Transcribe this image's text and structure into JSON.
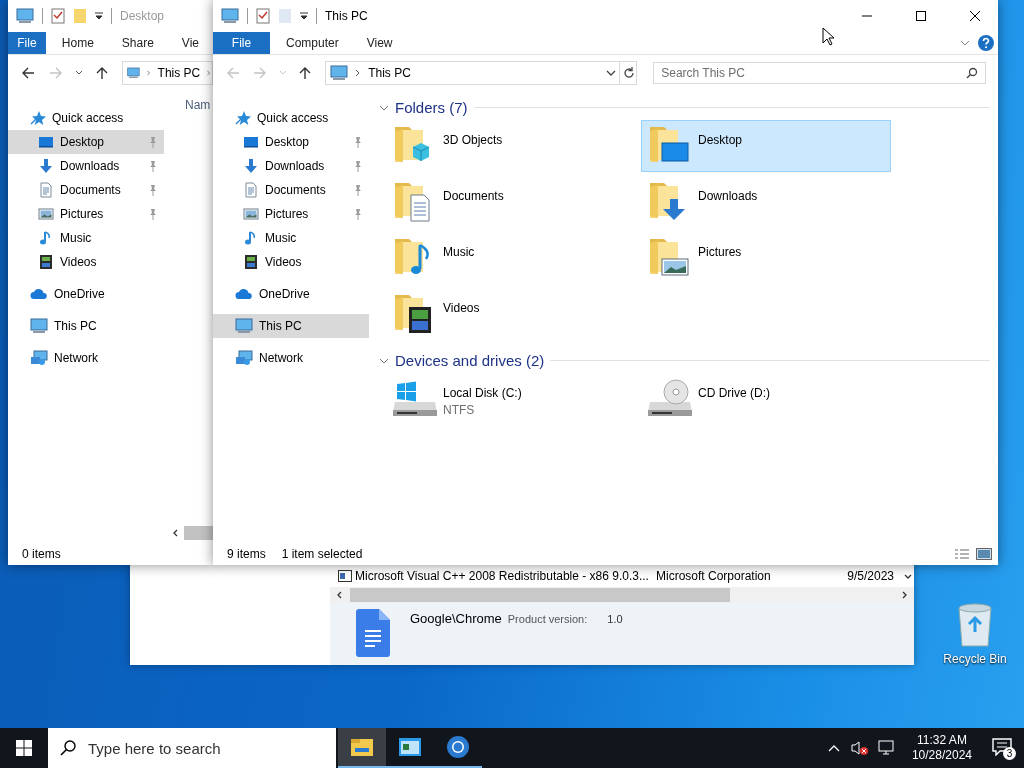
{
  "desktop": {
    "icons": [
      {
        "label": "Recycle Bin"
      }
    ]
  },
  "background_window": {
    "row": {
      "name": "Microsoft Visual C++ 2008 Redistributable - x86 9.0.3...",
      "publisher": "Microsoft Corporation",
      "installed_on": "9/5/2023"
    },
    "details": {
      "name": "Google\\Chrome",
      "field_label": "Product version:",
      "field_value": "1.0"
    }
  },
  "explorer_windows": [
    {
      "title": "Desktop",
      "active": false,
      "kind": "details",
      "window_controls": false,
      "ribbon_tabs": [
        {
          "label": "File",
          "kind": "file"
        },
        {
          "label": "Home",
          "kind": "tab"
        },
        {
          "label": "Share",
          "kind": "tab"
        },
        {
          "label": "Vie",
          "kind": "tab"
        }
      ],
      "nav": {
        "back_enabled": true,
        "forward_enabled": false
      },
      "address": {
        "crumbs": [
          "This PC"
        ],
        "has_more": true,
        "controls": false
      },
      "sidebar": [
        {
          "label": "Quick access",
          "kind": "star",
          "selected": false,
          "children": [
            {
              "label": "Desktop",
              "kind": "desktop",
              "pinned": true,
              "selected": true
            },
            {
              "label": "Downloads",
              "kind": "downloads",
              "pinned": true,
              "selected": false
            },
            {
              "label": "Documents",
              "kind": "documents",
              "pinned": true,
              "selected": false
            },
            {
              "label": "Pictures",
              "kind": "pictures",
              "pinned": true,
              "selected": false
            },
            {
              "label": "Music",
              "kind": "music",
              "pinned": false,
              "selected": false
            },
            {
              "label": "Videos",
              "kind": "videos",
              "pinned": false,
              "selected": false
            }
          ]
        },
        {
          "label": "OneDrive",
          "kind": "cloud",
          "selected": false
        },
        {
          "label": "This PC",
          "kind": "pc",
          "selected": false
        },
        {
          "label": "Network",
          "kind": "network",
          "selected": false
        }
      ],
      "column_header": "Nam",
      "status": [
        "0 items"
      ]
    },
    {
      "title": "This PC",
      "active": true,
      "kind": "tiles",
      "window_controls": true,
      "ribbon_tabs": [
        {
          "label": "File",
          "kind": "file"
        },
        {
          "label": "Computer",
          "kind": "tab"
        },
        {
          "label": "View",
          "kind": "tab"
        }
      ],
      "nav": {
        "back_enabled": false,
        "forward_enabled": false
      },
      "address": {
        "crumbs": [
          "This PC"
        ],
        "has_more": false,
        "controls": true
      },
      "search": {
        "placeholder": "Search This PC"
      },
      "sidebar": [
        {
          "label": "Quick access",
          "kind": "star",
          "selected": false,
          "children": [
            {
              "label": "Desktop",
              "kind": "desktop",
              "pinned": true,
              "selected": false
            },
            {
              "label": "Downloads",
              "kind": "downloads",
              "pinned": true,
              "selected": false
            },
            {
              "label": "Documents",
              "kind": "documents",
              "pinned": true,
              "selected": false
            },
            {
              "label": "Pictures",
              "kind": "pictures",
              "pinned": true,
              "selected": false
            },
            {
              "label": "Music",
              "kind": "music",
              "pinned": false,
              "selected": false
            },
            {
              "label": "Videos",
              "kind": "videos",
              "pinned": false,
              "selected": false
            }
          ]
        },
        {
          "label": "OneDrive",
          "kind": "cloud",
          "selected": false
        },
        {
          "label": "This PC",
          "kind": "pc",
          "selected": true
        },
        {
          "label": "Network",
          "kind": "network",
          "selected": false
        }
      ],
      "groups": [
        {
          "title": "Folders (7)",
          "expanded": true,
          "items": [
            {
              "label": "3D Objects",
              "kind": "objects",
              "selected": false
            },
            {
              "label": "Desktop",
              "kind": "desktop",
              "selected": true
            },
            {
              "label": "Documents",
              "kind": "documents",
              "selected": false
            },
            {
              "label": "Downloads",
              "kind": "downloads",
              "selected": false
            },
            {
              "label": "Music",
              "kind": "music",
              "selected": false
            },
            {
              "label": "Pictures",
              "kind": "pictures",
              "selected": false
            },
            {
              "label": "Videos",
              "kind": "videos",
              "selected": false
            }
          ]
        },
        {
          "title": "Devices and drives (2)",
          "expanded": true,
          "items": [
            {
              "label": "Local Disk (C:)",
              "sublabel": "NTFS",
              "kind": "system",
              "selected": false
            },
            {
              "label": "CD Drive (D:)",
              "kind": "disc",
              "selected": false
            }
          ]
        }
      ],
      "status": [
        "9 items",
        "1 item selected"
      ]
    }
  ],
  "taskbar": {
    "search": {
      "placeholder": "Type here to search"
    },
    "apps": [
      {
        "kind": "explorer",
        "selected": true
      },
      {
        "kind": "app",
        "selected": false
      },
      {
        "kind": "browser",
        "selected": false
      }
    ],
    "clock": {
      "time": "11:32 AM",
      "date": "10/28/2024"
    },
    "notifications": "3"
  }
}
